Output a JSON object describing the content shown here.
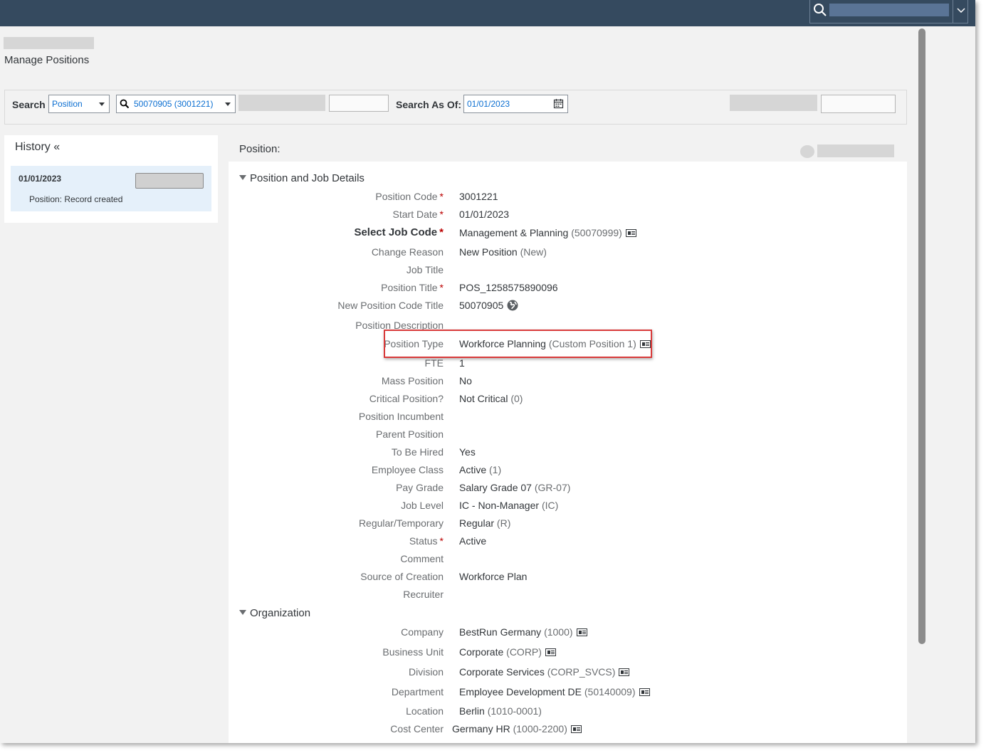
{
  "page": {
    "title": "Manage Positions"
  },
  "search_bar": {
    "search_label": "Search",
    "search_type": "Position",
    "search_value": "50070905 (3001221)",
    "as_of_label": "Search As Of:",
    "as_of_value": "01/01/2023"
  },
  "history": {
    "title": "History «",
    "entries": [
      {
        "date": "01/01/2023",
        "note": "Position: Record created"
      }
    ]
  },
  "main": {
    "title": "Position:",
    "sections": [
      {
        "title": "Position and Job Details",
        "fields": [
          {
            "label": "Position Code",
            "required": "*",
            "value": "3001221",
            "code": ""
          },
          {
            "label": "Start Date",
            "required": "*",
            "value": "01/01/2023",
            "code": ""
          },
          {
            "label": "Select Job Code",
            "required": "*",
            "value": "Management & Planning",
            "code": "(50070999)"
          },
          {
            "label": "Change Reason",
            "value": "New Position",
            "code": "(New)"
          },
          {
            "label": "Job Title",
            "value": "",
            "code": ""
          },
          {
            "label": "Position Title",
            "required": "*",
            "value": "POS_1258575890096",
            "code": ""
          },
          {
            "label": "New Position Code Title",
            "value": "50070905",
            "code": ""
          },
          {
            "label": "Position Description",
            "value": "",
            "code": ""
          },
          {
            "label": "Position Type",
            "value": "Workforce Planning",
            "code": "(Custom Position 1)"
          },
          {
            "label": "FTE",
            "value": "1",
            "code": ""
          },
          {
            "label": "Mass Position",
            "value": "No",
            "code": ""
          },
          {
            "label": "Critical Position?",
            "value": "Not Critical",
            "code": "(0)"
          },
          {
            "label": "Position Incumbent",
            "value": "",
            "code": ""
          },
          {
            "label": "Parent Position",
            "value": "",
            "code": ""
          },
          {
            "label": "To Be Hired",
            "value": "Yes",
            "code": ""
          },
          {
            "label": "Employee Class",
            "value": "Active",
            "code": "(1)"
          },
          {
            "label": "Pay Grade",
            "value": "Salary Grade 07",
            "code": "(GR-07)"
          },
          {
            "label": "Job Level",
            "value": "IC - Non-Manager",
            "code": "(IC)"
          },
          {
            "label": "Regular/Temporary",
            "value": "Regular",
            "code": "(R)"
          },
          {
            "label": "Status",
            "required": "*",
            "value": "Active",
            "code": ""
          },
          {
            "label": "Comment",
            "value": "",
            "code": ""
          },
          {
            "label": "Source of Creation",
            "value": "Workforce Plan",
            "code": ""
          },
          {
            "label": "Recruiter",
            "value": "",
            "code": ""
          }
        ]
      },
      {
        "title": "Organization",
        "fields": [
          {
            "label": "Company",
            "value": "BestRun Germany",
            "code": "(1000)"
          },
          {
            "label": "Business Unit",
            "value": "Corporate",
            "code": "(CORP)"
          },
          {
            "label": "Division",
            "value": "Corporate Services",
            "code": "(CORP_SVCS)"
          },
          {
            "label": "Department",
            "value": "Employee Development DE",
            "code": "(50140009)"
          },
          {
            "label": "Location",
            "value": "Berlin",
            "code": "(1010-0001)"
          },
          {
            "label": "Cost Center",
            "value": "Germany HR",
            "code": "(1000-2200)"
          }
        ]
      }
    ]
  },
  "icons": {
    "search": "magnifier-icon",
    "dropdown": "chevron-down-icon",
    "calendar": "calendar-icon",
    "details": "detail-card-icon",
    "globe": "globe-icon"
  },
  "colors": {
    "shell": "#354a5f",
    "link": "#0a6ed1",
    "required": "#bb0000",
    "highlight": "#d93a3a",
    "selected": "#e5f0fa"
  }
}
